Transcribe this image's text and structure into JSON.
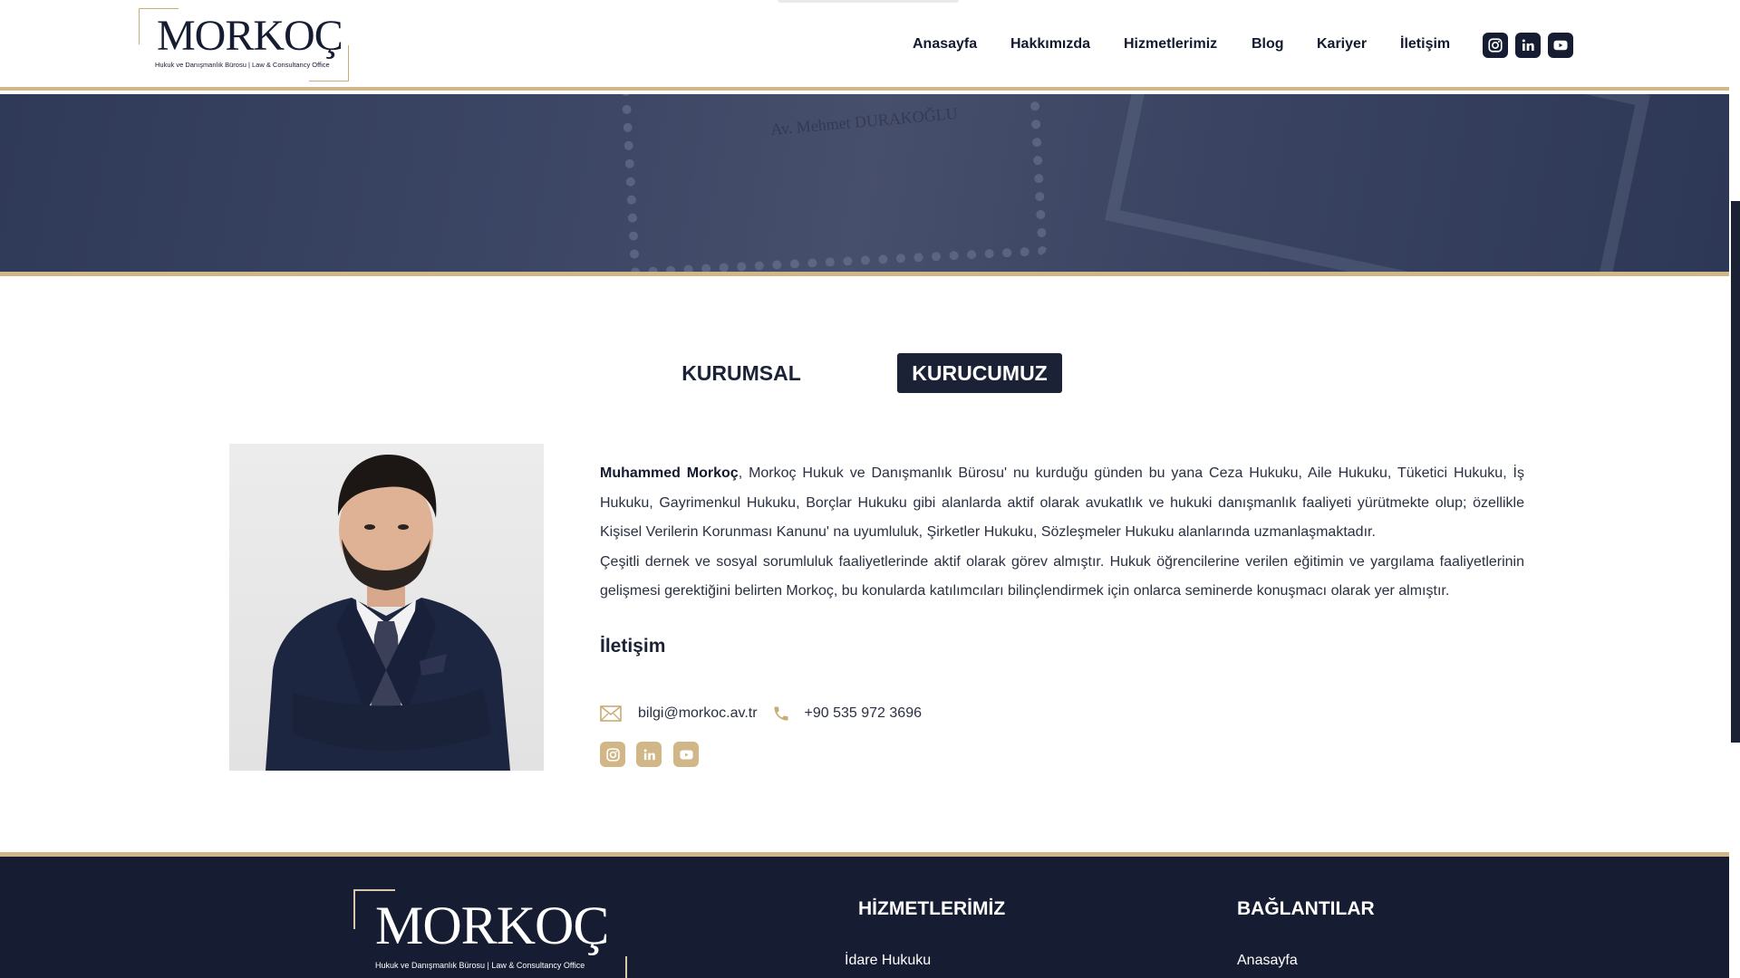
{
  "brand": {
    "name": "MORKOÇ",
    "tagline": "Hukuk ve Danışmanlık Bürosu | Law & Consultancy Office",
    "accent_color": "#d1b787",
    "navy_color": "#1b2236"
  },
  "nav": {
    "items": [
      {
        "label": "Anasayfa"
      },
      {
        "label": "Hakkımızda"
      },
      {
        "label": "Hizmetlerimiz"
      },
      {
        "label": "Blog"
      },
      {
        "label": "Kariyer"
      },
      {
        "label": "İletişim"
      }
    ],
    "social_icons": [
      "instagram-icon",
      "linkedin-icon",
      "youtube-icon"
    ]
  },
  "hero": {
    "doc_text": "Av. Mehmet DURAKOĞLU"
  },
  "tabs": [
    {
      "label": "KURUMSAL",
      "active": false
    },
    {
      "label": "KURUCUMUZ",
      "active": true
    }
  ],
  "founder": {
    "name": "Muhammed Morkoç",
    "paragraph1": ", Morkoç Hukuk ve Danışmanlık Bürosu' nu kurduğu günden bu yana Ceza Hukuku, Aile Hukuku, Tüketici Hukuku, İş Hukuku, Gayrimenkul Hukuku, Borçlar Hukuku gibi alanlarda aktif olarak avukatlık ve hukuki danışmanlık faaliyeti yürütmekte olup; özellikle Kişisel Verilerin Korunması Kanunu' na uyumluluk, Şirketler Hukuku, Sözleşmeler Hukuku alanlarında uzmanlaşmaktadır.",
    "paragraph2": "Çeşitli dernek ve sosyal sorumluluk faaliyetlerinde aktif olarak görev almıştır. Hukuk öğrencilerine verilen eğitimin ve yargılama faaliyetlerinin gelişmesi gerektiğini belirten Morkoç, bu konularda katılımcıları bilinçlendirmek için onlarca seminerde konuşmacı olarak yer almıştır."
  },
  "contact": {
    "title": "İletişim",
    "email": "bilgi@morkoc.av.tr",
    "phone": "+90 535 972 3696",
    "social_icons": [
      "instagram-icon",
      "linkedin-icon",
      "youtube-icon"
    ]
  },
  "footer": {
    "services_heading": "HİZMETLERİMİZ",
    "links_heading": "BAĞLANTILAR",
    "services_first": "İdare Hukuku",
    "links_first": "Anasayfa"
  }
}
